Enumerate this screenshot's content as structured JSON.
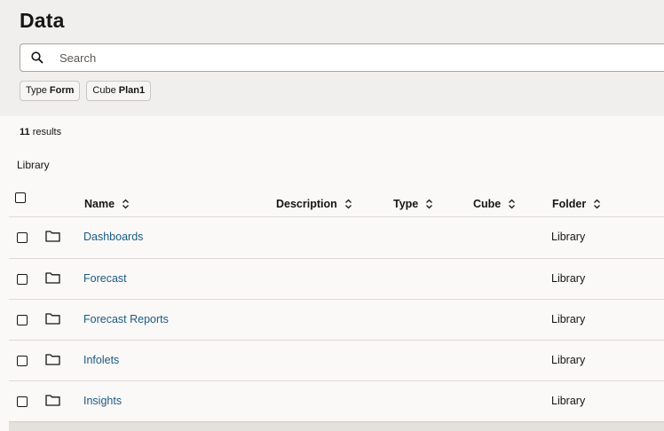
{
  "page": {
    "title": "Data"
  },
  "search": {
    "placeholder": "Search",
    "value": ""
  },
  "filters": [
    {
      "key": "Type",
      "value": "Form"
    },
    {
      "key": "Cube",
      "value": "Plan1"
    }
  ],
  "results": {
    "count": "11",
    "label": "results"
  },
  "section": {
    "title": "Library"
  },
  "columns": {
    "name": "Name",
    "description": "Description",
    "type": "Type",
    "cube": "Cube",
    "folder": "Folder"
  },
  "rows": [
    {
      "name": "Dashboards",
      "description": "",
      "type": "",
      "cube": "",
      "folder": "Library",
      "icon": "folder-icon"
    },
    {
      "name": "Forecast",
      "description": "",
      "type": "",
      "cube": "",
      "folder": "Library",
      "icon": "folder-icon"
    },
    {
      "name": "Forecast Reports",
      "description": "",
      "type": "",
      "cube": "",
      "folder": "Library",
      "icon": "folder-icon"
    },
    {
      "name": "Infolets",
      "description": "",
      "type": "",
      "cube": "",
      "folder": "Library",
      "icon": "folder-icon"
    },
    {
      "name": "Insights",
      "description": "",
      "type": "",
      "cube": "",
      "folder": "Library",
      "icon": "folder-icon"
    }
  ],
  "colors": {
    "link": "#1b5a82",
    "header_bg": "#f1efed",
    "content_bg": "#fbf9f8",
    "divider": "#dcd9d5"
  }
}
